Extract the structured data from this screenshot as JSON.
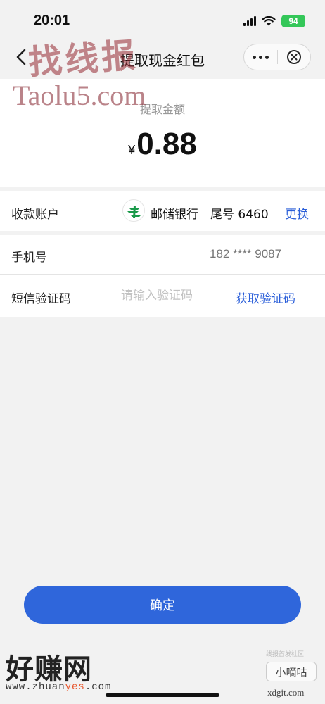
{
  "status_bar": {
    "time": "20:01",
    "battery": "94"
  },
  "nav": {
    "title": "提取现金红包",
    "back_icon": "chevron-left-icon",
    "more_icon": "more-dots-icon",
    "close_icon": "close-circle-icon"
  },
  "amount": {
    "label": "提取金额",
    "currency": "¥",
    "value": "0.88"
  },
  "account": {
    "label": "收款账户",
    "bank_name": "邮储银行",
    "tail_number": "尾号 6460",
    "change_label": "更换",
    "bank_icon": "postal-savings-bank-logo"
  },
  "phone": {
    "label": "手机号",
    "value": "182 **** 9087"
  },
  "sms": {
    "label": "短信验证码",
    "placeholder": "请输入验证码",
    "get_code_label": "获取验证码"
  },
  "confirm_label": "确定",
  "watermarks": {
    "top_cn": "找线报",
    "top_en": "Taolu5.com",
    "bottom_cn": "好赚网",
    "bottom_url_prefix": "www.zhuan",
    "bottom_url_highlight": "yes",
    "bottom_url_suffix": ".com",
    "xd_small": "线报首发社区",
    "xd_badge": "小嘀咕",
    "xd_domain": "xdgit.com"
  },
  "colors": {
    "accent": "#2f66db",
    "link": "#2b5fd9",
    "battery": "#34c759",
    "background": "#f2f2f2"
  }
}
